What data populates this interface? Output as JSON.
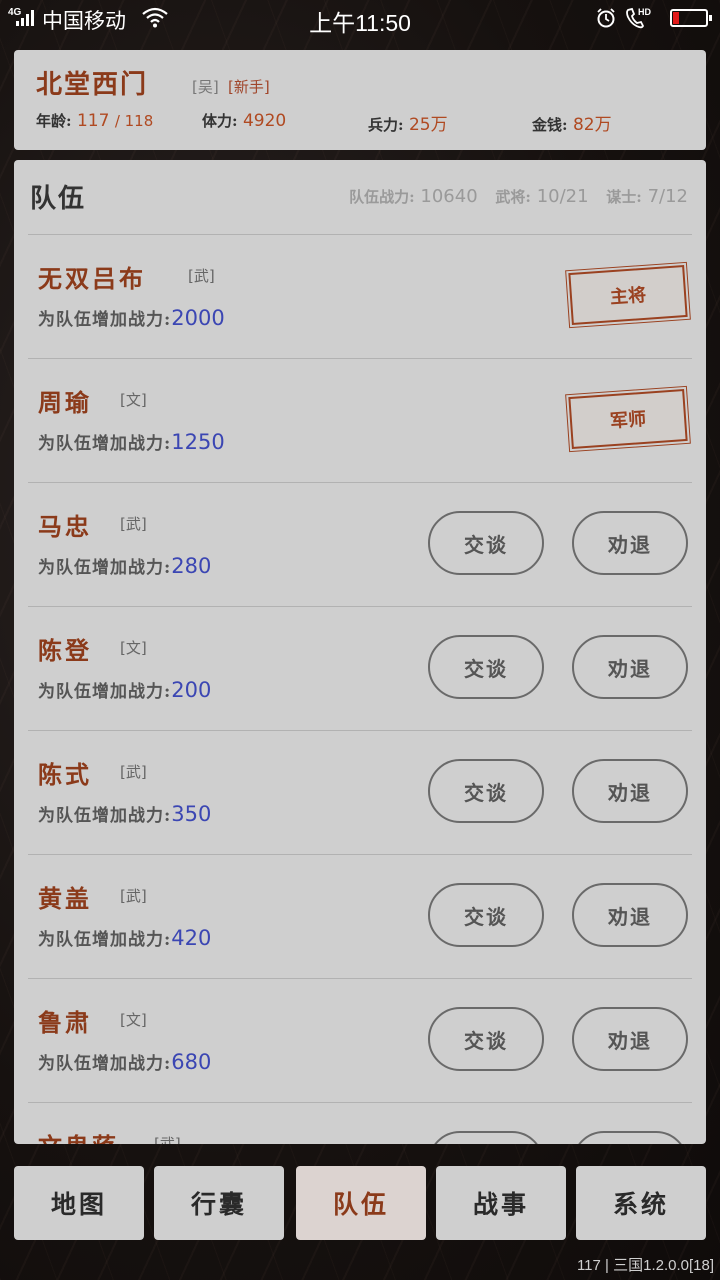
{
  "status_bar": {
    "network": "4G",
    "carrier": "中国移动",
    "time": "上午11:50",
    "hd": "HD"
  },
  "player": {
    "name": "北堂西门",
    "faction": "[吴]",
    "rank": "[新手]",
    "age_label": "年龄:",
    "age": "117",
    "age_max": "/ 118",
    "stamina_label": "体力:",
    "stamina": "4920",
    "troops_label": "兵力:",
    "troops": "25万",
    "money_label": "金钱:",
    "money": "82万"
  },
  "team": {
    "title": "队伍",
    "power_label": "队伍战力:",
    "power": "10640",
    "generals_label": "武将:",
    "generals": "10/21",
    "advisors_label": "谋士:",
    "advisors": "7/12",
    "bonus_label": "为队伍增加战力:",
    "talk_label": "交谈",
    "dismiss_label": "劝退",
    "members": [
      {
        "name": "无双吕布",
        "type": "[武]",
        "bonus": "2000",
        "stamp": "主将"
      },
      {
        "name": "周瑜",
        "type": "[文]",
        "bonus": "1250",
        "stamp": "军师"
      },
      {
        "name": "马忠",
        "type": "[武]",
        "bonus": "280"
      },
      {
        "name": "陈登",
        "type": "[文]",
        "bonus": "200"
      },
      {
        "name": "陈式",
        "type": "[武]",
        "bonus": "350"
      },
      {
        "name": "黄盖",
        "type": "[武]",
        "bonus": "420"
      },
      {
        "name": "鲁肃",
        "type": "[文]",
        "bonus": "680"
      },
      {
        "name": "文鬼蒋",
        "type": "[武]",
        "bonus": ""
      }
    ]
  },
  "tabs": [
    "地图",
    "行囊",
    "队伍",
    "战事",
    "系统"
  ],
  "active_tab": "队伍",
  "version": "117 | 三国1.2.0.0[18]",
  "colors": {
    "name_accent": "#8b3a1a",
    "bonus_value": "#3b46b3",
    "panel_bg": "#cfcfcf"
  }
}
